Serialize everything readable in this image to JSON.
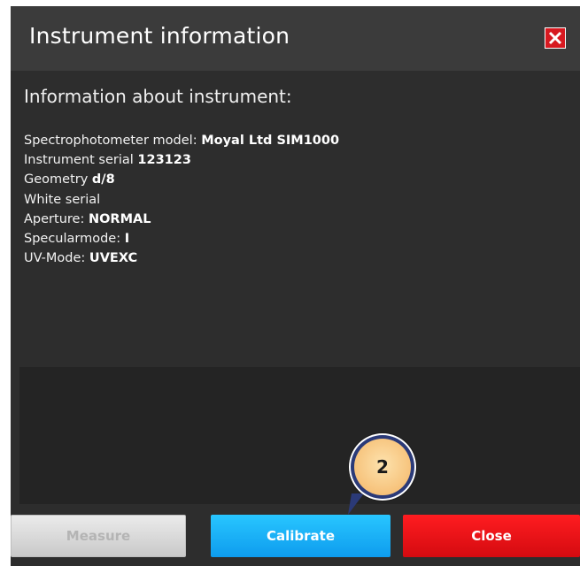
{
  "dialog": {
    "title": "Instrument information",
    "close_icon": "close-icon"
  },
  "content": {
    "section_title": "Information about instrument:",
    "rows": [
      {
        "label": "Spectrophotometer model: ",
        "value": "Moyal Ltd SIM1000"
      },
      {
        "label": "Instrument serial ",
        "value": "123123"
      },
      {
        "label": "Geometry ",
        "value": "d/8"
      },
      {
        "label": "White serial",
        "value": ""
      },
      {
        "label": "Aperture: ",
        "value": "NORMAL"
      },
      {
        "label": "Specularmode: ",
        "value": "I"
      },
      {
        "label": "UV-Mode: ",
        "value": "UVEXC"
      }
    ]
  },
  "buttons": {
    "measure": "Measure",
    "calibrate": "Calibrate",
    "close": "Close"
  },
  "step_marker": "2",
  "colors": {
    "dialog_bg": "#2d2d2d",
    "titlebar_bg": "#3b3b3b",
    "calibrate": "#17b0f5",
    "close": "#e8121a",
    "marker_ring": "#2b3a78",
    "marker_fill": "#f6c077"
  }
}
